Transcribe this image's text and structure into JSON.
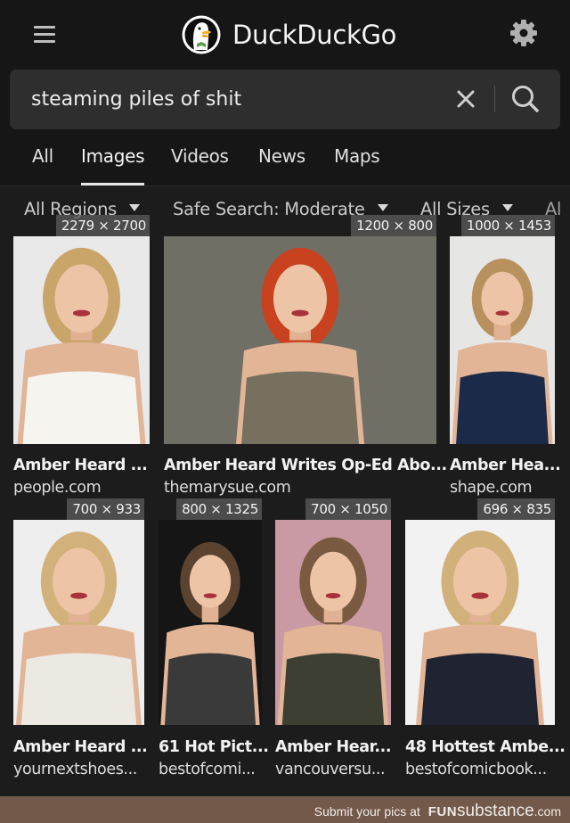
{
  "header": {
    "brand": "DuckDuckGo",
    "menu_icon": "hamburger-menu-icon",
    "settings_icon": "gear-icon"
  },
  "search": {
    "query": "steaming piles of shit",
    "clear_icon": "close-icon",
    "submit_icon": "search-icon"
  },
  "tabs": [
    {
      "label": "All",
      "active": false
    },
    {
      "label": "Images",
      "active": true
    },
    {
      "label": "Videos",
      "active": false
    },
    {
      "label": "News",
      "active": false
    },
    {
      "label": "Maps",
      "active": false
    }
  ],
  "filters": [
    {
      "label": "All Regions"
    },
    {
      "label": "Safe Search: Moderate"
    },
    {
      "label": "All Sizes"
    },
    {
      "label": "Al"
    }
  ],
  "results": [
    {
      "title": "Amber Heard ...",
      "source": "people.com",
      "dimensions": "2279 × 2700",
      "bg": "#e9e9ea",
      "hair": "#c9a56a",
      "outfit": "#f6f4ef"
    },
    {
      "title": "Amber Heard Writes Op-Ed Abo...",
      "source": "themarysue.com",
      "dimensions": "1200 × 800",
      "bg": "#6f6f66",
      "hair": "#c8421f",
      "outfit": "#77705f"
    },
    {
      "title": "Amber Hea...",
      "source": "shape.com",
      "dimensions": "1000 × 1453",
      "bg": "#e6e6e4",
      "hair": "#b8915e",
      "outfit": "#1c2a4a"
    },
    {
      "title": "Amber Heard ...",
      "source": "yournextshoes...",
      "dimensions": "700 × 933",
      "bg": "#eeeeef",
      "hair": "#d2b27a",
      "outfit": "#ece8e2"
    },
    {
      "title": "61 Hot Pict...",
      "source": "bestofcomi...",
      "dimensions": "800 × 1325",
      "bg": "#151515",
      "hair": "#5b4330",
      "outfit": "#3a3a3a"
    },
    {
      "title": "Amber Hear...",
      "source": "vancouversu...",
      "dimensions": "700 × 1050",
      "bg": "#c99aa3",
      "hair": "#7a5a40",
      "outfit": "#3d3f33"
    },
    {
      "title": "48 Hottest Ambe...",
      "source": "bestofcomicbook...",
      "dimensions": "696 × 835",
      "bg": "#f2f2f2",
      "hair": "#d1b079",
      "outfit": "#1f2332"
    }
  ],
  "footer": {
    "prefix": "Submit your pics at",
    "brand_fun": "FUN",
    "brand_sub": "substance",
    "brand_com": ".com"
  },
  "colors": {
    "page_bg": "#161616",
    "search_bg": "#2e2e2e",
    "grid_bg": "#1c1c1c",
    "footer_bg": "#72594a",
    "duck_green": "#5b9e4d",
    "duck_beak": "#f2b12e"
  }
}
